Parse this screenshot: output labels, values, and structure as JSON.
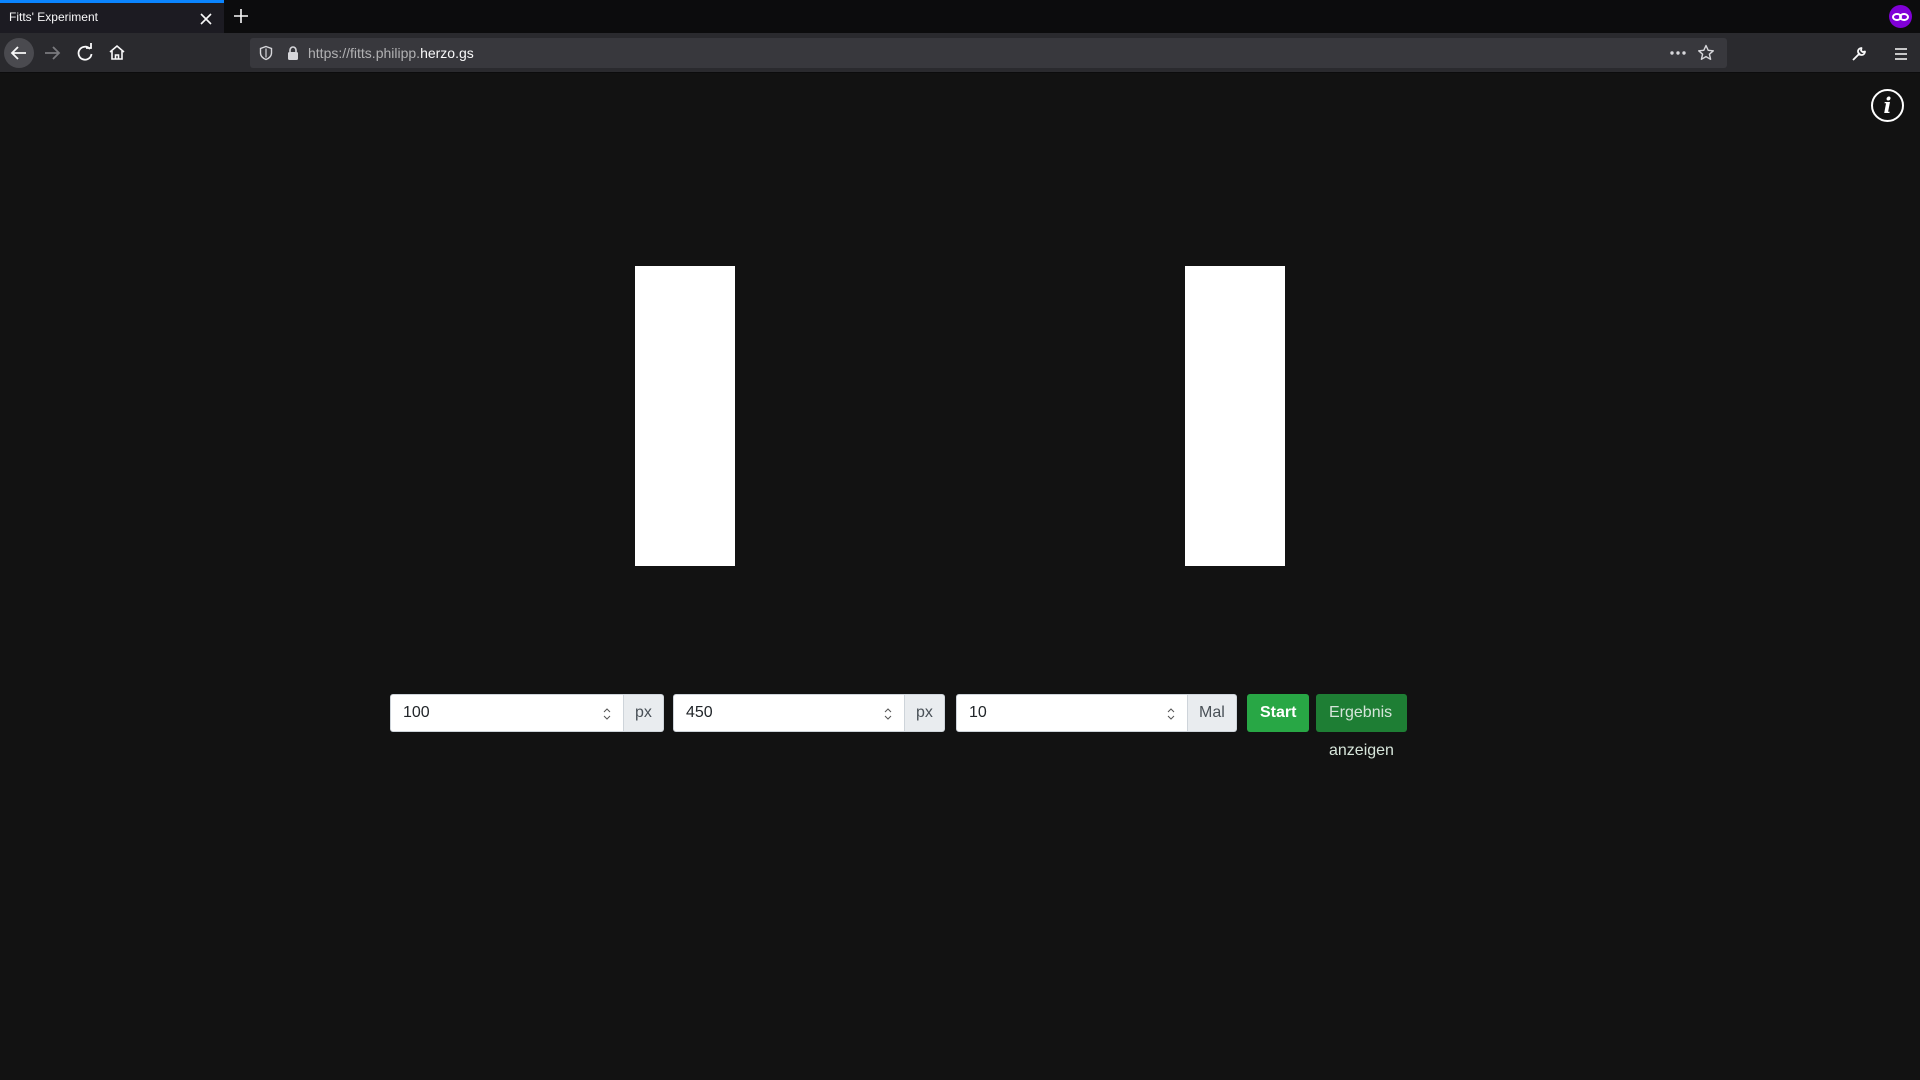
{
  "browser": {
    "tab_title": "Fitts' Experiment",
    "url_prefix": "https://fitts.philipp.",
    "url_domain": "herzo.gs"
  },
  "page": {
    "info_label": "i"
  },
  "controls": {
    "width_value": "100",
    "width_unit": "px",
    "distance_value": "450",
    "distance_unit": "px",
    "repetitions_value": "10",
    "repetitions_unit": "Mal",
    "start_label": "Start",
    "result_label": "Ergebnis anzeigen"
  },
  "colors": {
    "background": "#121212",
    "target": "#ffffff",
    "start_button": "#28a745",
    "result_button": "#1e7e34",
    "tab_accent": "#0a84ff",
    "private_badge": "#8000d7"
  }
}
